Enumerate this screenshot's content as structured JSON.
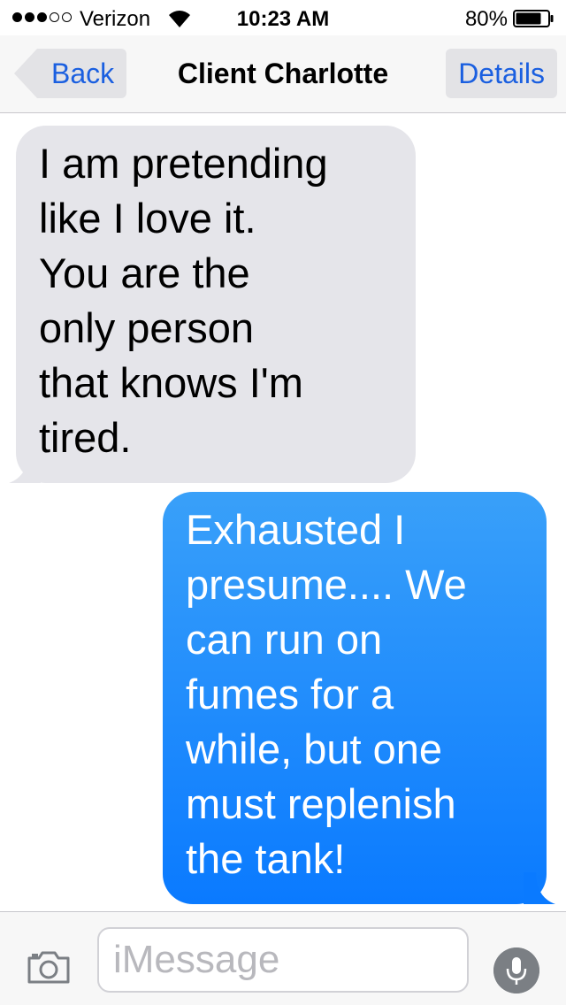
{
  "status_bar": {
    "carrier": "Verizon",
    "signal_bars_filled": 3,
    "signal_bars_total": 5,
    "time": "10:23 AM",
    "battery_percent": "80%",
    "battery_level": 0.8
  },
  "nav_bar": {
    "back_label": "Back",
    "title": "Client Charlotte",
    "details_label": "Details"
  },
  "messages": [
    {
      "direction": "incoming",
      "text": "I am pretending\nlike I love it.\nYou are the\nonly person\nthat knows I'm\ntired."
    },
    {
      "direction": "outgoing",
      "text": "Exhausted I\npresume.... We\ncan run on\nfumes for a\nwhile, but one\nmust replenish\nthe tank!"
    }
  ],
  "input_bar": {
    "placeholder": "iMessage",
    "camera_icon": "camera-icon",
    "mic_icon": "microphone-icon"
  },
  "colors": {
    "incoming_bubble": "#e5e5ea",
    "outgoing_bubble": "#0a7aff",
    "accent": "#1a5fe0"
  }
}
